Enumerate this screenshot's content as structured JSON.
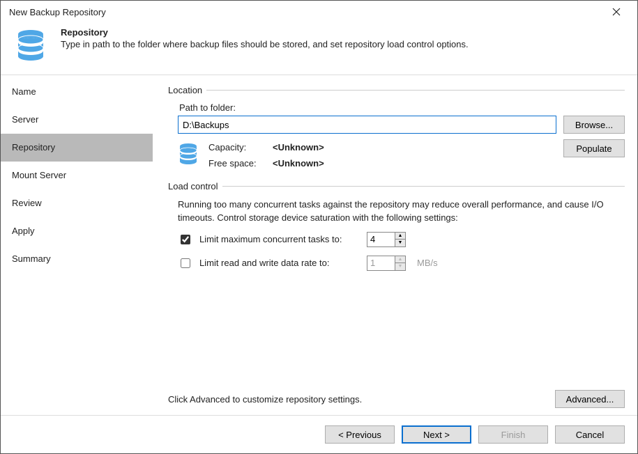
{
  "window": {
    "title": "New Backup Repository"
  },
  "header": {
    "title": "Repository",
    "subtitle": "Type in path to the folder where backup files should be stored, and set repository load control options."
  },
  "nav": {
    "items": [
      {
        "label": "Name"
      },
      {
        "label": "Server"
      },
      {
        "label": "Repository"
      },
      {
        "label": "Mount Server"
      },
      {
        "label": "Review"
      },
      {
        "label": "Apply"
      },
      {
        "label": "Summary"
      }
    ],
    "selected_index": 2
  },
  "location": {
    "group_label": "Location",
    "path_label": "Path to folder:",
    "path_value": "D:\\Backups",
    "browse_label": "Browse...",
    "populate_label": "Populate",
    "capacity_label": "Capacity:",
    "capacity_value": "<Unknown>",
    "free_label": "Free space:",
    "free_value": "<Unknown>"
  },
  "load_control": {
    "group_label": "Load control",
    "description": "Running too many concurrent tasks against the repository may reduce overall performance, and cause I/O timeouts. Control storage device saturation with the following settings:",
    "limit_tasks_label": "Limit maximum concurrent tasks to:",
    "limit_tasks_checked": true,
    "limit_tasks_value": "4",
    "limit_rate_label": "Limit read and write data rate to:",
    "limit_rate_checked": false,
    "limit_rate_value": "1",
    "limit_rate_unit": "MB/s"
  },
  "advanced": {
    "hint": "Click Advanced to customize repository settings.",
    "button_label": "Advanced..."
  },
  "footer": {
    "previous": "< Previous",
    "next": "Next >",
    "finish": "Finish",
    "cancel": "Cancel"
  },
  "icons": {
    "db_color": "#4fa7e6"
  }
}
